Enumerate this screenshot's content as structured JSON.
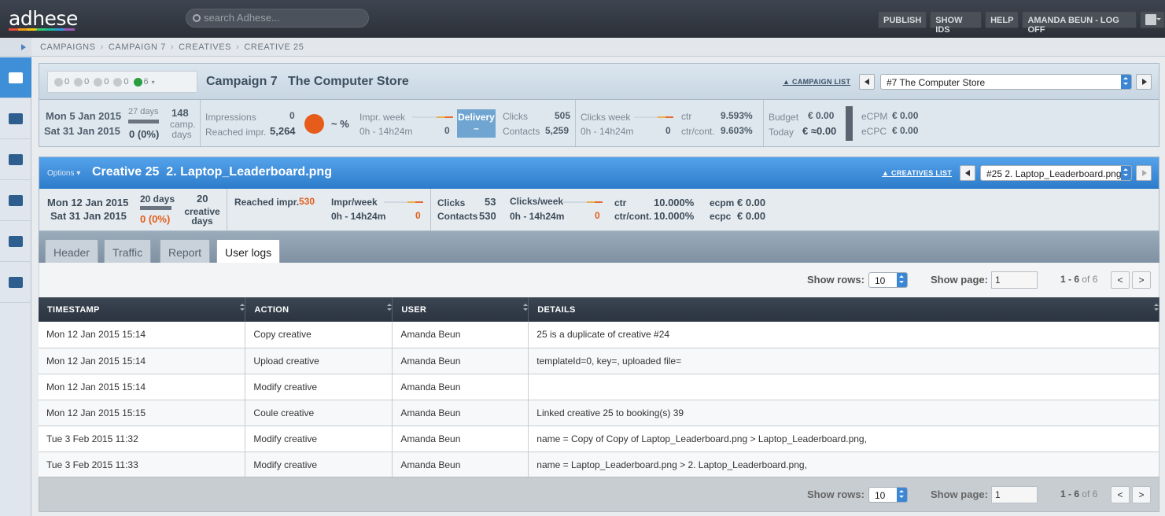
{
  "app": {
    "logo": "adhese",
    "search_placeholder": "search Adhese..."
  },
  "topnav": {
    "publish": "PUBLISH",
    "show_ids": "SHOW IDS",
    "help": "HELP",
    "user": "AMANDA BEUN - LOG OFF"
  },
  "breadcrumb": [
    "CAMPAIGNS",
    "CAMPAIGN 7",
    "CREATIVES",
    "CREATIVE 25"
  ],
  "campaign": {
    "status_counts": [
      "0",
      "0",
      "0",
      "0",
      "6"
    ],
    "label": "Campaign 7",
    "name": "The Computer Store",
    "list_link": "CAMPAIGN LIST",
    "select_value": "#7 The Computer Store",
    "start": "Mon 5 Jan 2015",
    "end": "Sat 31 Jan 2015",
    "days": "27 days",
    "days_done": "0 (0%)",
    "camp_days_count": "148",
    "camp_days_label": "camp. days",
    "impressions_label": "Impressions",
    "impressions": "0",
    "reached_label": "Reached impr.",
    "reached": "5,264",
    "pct": "~ %",
    "impr_week_label": "Impr. week",
    "impr_week_time": "0h - 14h24m",
    "impr_week_value": "0",
    "delivery_label": "Delivery",
    "delivery_value": "–",
    "clicks_label": "Clicks",
    "clicks": "505",
    "contacts_label": "Contacts",
    "contacts": "5,259",
    "clicks_week_label": "Clicks week",
    "clicks_week_time": "0h - 14h24m",
    "clicks_week_value": "0",
    "ctr_label": "ctr",
    "ctr": "9.593%",
    "ctr_cont_label": "ctr/cont.",
    "ctr_cont": "9.603%",
    "budget_label": "Budget",
    "budget": "€ 0.00",
    "today_label": "Today",
    "today": "€ ≈0.00",
    "ecpm_label": "eCPM",
    "ecpm": "€ 0.00",
    "ecpc_label": "eCPC",
    "ecpc": "€ 0.00"
  },
  "creative": {
    "options": "Options",
    "label": "Creative 25",
    "name": "2. Laptop_Leaderboard.png",
    "list_link": "CREATIVES LIST",
    "select_value": "#25 2. Laptop_Leaderboard.png",
    "start": "Mon 12 Jan 2015",
    "end": "Sat 31 Jan 2015",
    "days": "20 days",
    "days_done": "0 (0%)",
    "creative_days_count": "20",
    "creative_days_label": "creative days",
    "reached_label": "Reached impr.",
    "reached": "530",
    "impr_week_label": "Impr/week",
    "impr_week_time": "0h - 14h24m",
    "impr_week_value": "0",
    "clicks_label": "Clicks",
    "clicks": "53",
    "contacts_label": "Contacts",
    "contacts": "530",
    "clicks_week_label": "Clicks/week",
    "clicks_week_time": "0h - 14h24m",
    "clicks_week_value": "0",
    "ctr_label": "ctr",
    "ctr": "10.000%",
    "ctr_cont_label": "ctr/cont.",
    "ctr_cont": "10.000%",
    "ecpm_label": "ecpm",
    "ecpm": "€ 0.00",
    "ecpc_label": "ecpc",
    "ecpc": "€ 0.00"
  },
  "tabs": [
    "Header",
    "Traffic",
    "Report",
    "User logs"
  ],
  "active_tab": "User logs",
  "toolbar": {
    "show_rows_label": "Show rows:",
    "rows": "10",
    "show_page_label": "Show page:",
    "page": "1",
    "range": "1 - 6",
    "of": "of 6",
    "prev": "<",
    "next": ">"
  },
  "table": {
    "headers": [
      "TIMESTAMP",
      "ACTION",
      "USER",
      "DETAILS"
    ],
    "rows": [
      [
        "Mon 12 Jan 2015 15:14",
        "Copy creative",
        "Amanda Beun",
        "25 is a duplicate of creative #24"
      ],
      [
        "Mon 12 Jan 2015 15:14",
        "Upload creative",
        "Amanda Beun",
        "templateId=0, key=, uploaded file="
      ],
      [
        "Mon 12 Jan 2015 15:14",
        "Modify creative",
        "Amanda Beun",
        ""
      ],
      [
        "Mon 12 Jan 2015 15:15",
        "Coule creative",
        "Amanda Beun",
        "Linked creative 25 to booking(s) 39"
      ],
      [
        "Tue 3 Feb 2015 11:32",
        "Modify creative",
        "Amanda Beun",
        "name = Copy of Copy of Laptop_Leaderboard.png > Laptop_Leaderboard.png,"
      ],
      [
        "Tue 3 Feb 2015 11:33",
        "Modify creative",
        "Amanda Beun",
        "name = Laptop_Leaderboard.png > 2. Laptop_Leaderboard.png,"
      ]
    ]
  },
  "colors": {
    "accent": "#3f8fd8",
    "orange": "#e65c1a",
    "header_dark": "#2b3440"
  }
}
